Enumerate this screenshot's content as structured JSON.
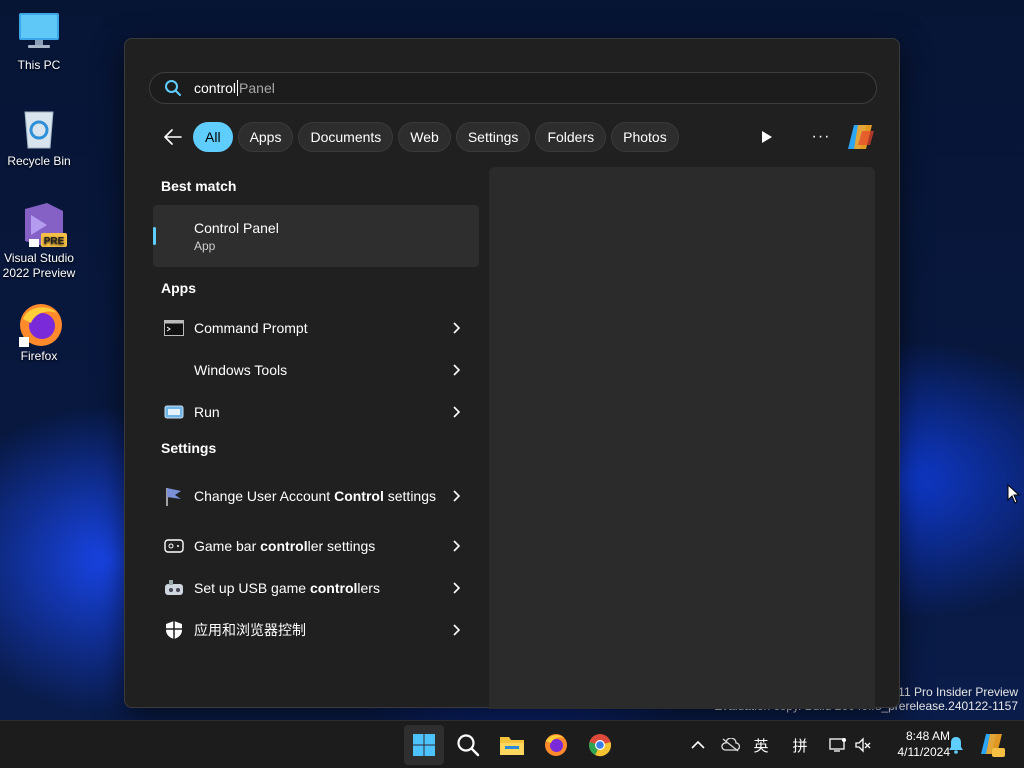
{
  "desktop": {
    "icons": [
      {
        "name": "this-pc",
        "label": "This PC"
      },
      {
        "name": "recycle-bin",
        "label": "Recycle Bin"
      },
      {
        "name": "visual-studio",
        "label": "Visual Studio 2022 Preview",
        "badge": "PRE"
      },
      {
        "name": "firefox",
        "label": "Firefox"
      }
    ],
    "watermark": {
      "line1": "s 11 Pro Insider Preview",
      "line2": "Evaluation copy. Build 26040.rs_prerelease.240122-1157"
    }
  },
  "search": {
    "typed": "control ",
    "suggestion": "Panel",
    "search_icon": "search-icon"
  },
  "filters": {
    "back_icon": "back-arrow-icon",
    "chips": [
      {
        "label": "All",
        "active": true
      },
      {
        "label": "Apps"
      },
      {
        "label": "Documents"
      },
      {
        "label": "Web"
      },
      {
        "label": "Settings"
      },
      {
        "label": "Folders"
      },
      {
        "label": "Photos"
      }
    ],
    "play_icon": "play-icon",
    "more_label": "···",
    "copilot_icon": "copilot-icon"
  },
  "results": {
    "best_match_header": "Best match",
    "best_match": {
      "title": "Control Panel",
      "subtitle": "App"
    },
    "apps_header": "Apps",
    "apps": [
      {
        "label": "Command Prompt",
        "icon": "command-prompt-icon"
      },
      {
        "label": "Windows Tools",
        "icon": "windows-tools-icon"
      },
      {
        "label": "Run",
        "icon": "run-icon"
      }
    ],
    "settings_header": "Settings",
    "settings": [
      {
        "pre": "Change User Account ",
        "bold": "Control",
        "post": " settings",
        "icon": "uac-flag-icon"
      },
      {
        "pre": "Game bar ",
        "bold": "control",
        "post": "ler settings",
        "icon": "game-bar-icon"
      },
      {
        "pre": "Set up USB game ",
        "bold": "control",
        "post": "lers",
        "icon": "usb-gamepad-icon"
      },
      {
        "pre": "应用和浏览器控制",
        "bold": "",
        "post": "",
        "icon": "shield-icon"
      }
    ]
  },
  "taskbar": {
    "ime_label": "英",
    "ime_mode": "拼",
    "time": "8:48 AM",
    "date": "4/11/2024"
  },
  "colors": {
    "accent": "#60cdff",
    "panel_bg": "#202020",
    "preview_bg": "#2b2b2b",
    "taskbar_bg": "#1c1c1c"
  }
}
